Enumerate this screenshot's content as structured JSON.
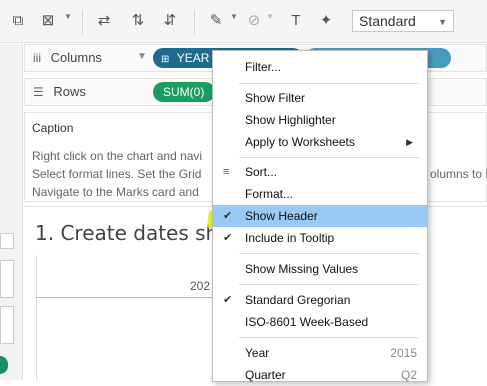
{
  "toolbar": {
    "icons": [
      "format-painter-icon",
      "clear-sheet-icon",
      "swap-icon",
      "sort-ascending-icon",
      "sort-descending-icon",
      "highlight-pen-icon",
      "paperclip-icon",
      "text-box-icon",
      "pin-icon"
    ],
    "fit_select": "Standard"
  },
  "shelves": {
    "columns": {
      "label": "Columns",
      "pills": [
        "YEAR",
        ""
      ]
    },
    "rows": {
      "label": "Rows",
      "pills": [
        "SUM(0)"
      ]
    }
  },
  "caption": {
    "title": "Caption",
    "lines": [
      "Right click on the chart and navi",
      "Select format lines. Set the Grid",
      "Navigate to the Marks card and",
      "olumns to N"
    ]
  },
  "view": {
    "sheet_title": "1. Create dates she",
    "axis_label": "202"
  },
  "context_menu": {
    "items": [
      {
        "label": "Filter..."
      },
      {
        "label": "Show Filter"
      },
      {
        "label": "Show Highlighter"
      },
      {
        "label": "Apply to Worksheets",
        "submenu": true
      },
      {
        "label": "Sort...",
        "icon": "sort-icon"
      },
      {
        "label": "Format..."
      },
      {
        "label": "Show Header",
        "checked": true,
        "highlighted": true
      },
      {
        "label": "Include in Tooltip",
        "checked": true
      },
      {
        "label": "Show Missing Values"
      },
      {
        "label": "Standard Gregorian",
        "checked": true
      },
      {
        "label": "ISO-8601 Week-Based"
      },
      {
        "label": "Year",
        "value": "2015"
      },
      {
        "label": "Quarter",
        "value": "Q2"
      }
    ]
  },
  "colors": {
    "highlight": "#99c9f5",
    "marker": "#e4f500",
    "pill_blue": "#1f6b8e",
    "pill_green": "#1a9e5f"
  }
}
